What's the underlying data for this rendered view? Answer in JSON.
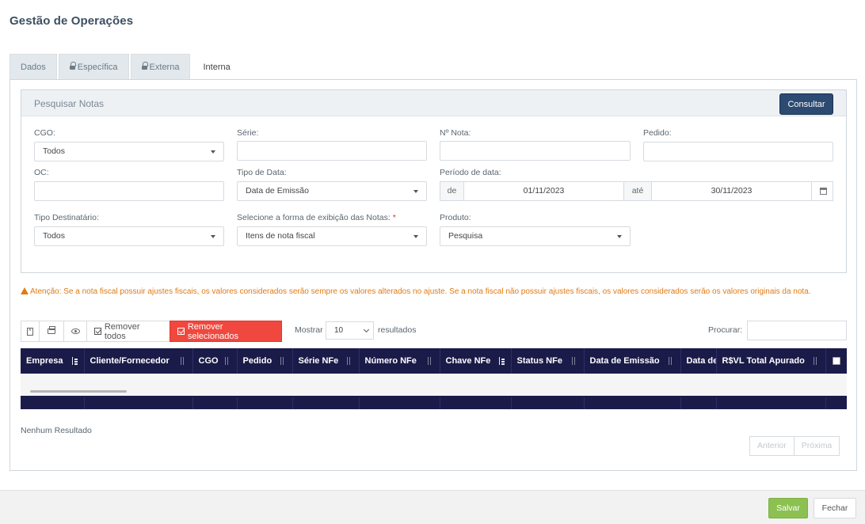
{
  "title": "Gestão de Operações",
  "tabs": [
    {
      "label": "Dados",
      "locked": false,
      "active": false
    },
    {
      "label": "Específica",
      "locked": true,
      "active": false
    },
    {
      "label": "Externa",
      "locked": true,
      "active": false
    },
    {
      "label": "Interna",
      "locked": false,
      "active": true
    }
  ],
  "search": {
    "title": "Pesquisar Notas",
    "consult_label": "Consultar",
    "fields": {
      "cgo": {
        "label": "CGO:",
        "value": "Todos"
      },
      "serie": {
        "label": "Série:",
        "value": ""
      },
      "nota": {
        "label": "Nº Nota:",
        "value": ""
      },
      "pedido": {
        "label": "Pedido:",
        "value": ""
      },
      "oc": {
        "label": "OC:",
        "value": ""
      },
      "tipo_data": {
        "label": "Tipo de Data:",
        "value": "Data de Emissão"
      },
      "periodo": {
        "label": "Período de data:",
        "de": "de",
        "start": "01/11/2023",
        "ate": "até",
        "end": "30/11/2023"
      },
      "tipo_destinatario": {
        "label": "Tipo Destinatário:",
        "value": "Todos"
      },
      "forma_exibicao": {
        "label": "Selecione a forma de exibição das Notas:",
        "required": "*",
        "value": "Itens de nota fiscal"
      },
      "produto": {
        "label": "Produto:",
        "value": "Pesquisa"
      }
    }
  },
  "warning": "Atenção: Se a nota fiscal possuir ajustes fiscais, os valores considerados serão sempre os valores alterados no ajuste. Se a nota fiscal não possuir ajustes fiscais, os valores considerados serão os valores originais da nota.",
  "toolbar": {
    "remove_all": "Remover todos",
    "remove_selected": "Remover selecionados",
    "show_label": "Mostrar",
    "page_length": "10",
    "results_label": "resultados",
    "search_label": "Procurar:"
  },
  "table": {
    "columns": [
      "Empresa",
      "Cliente/Fornecedor",
      "CGO",
      "Pedido",
      "Série NFe",
      "Número NFe",
      "Chave NFe",
      "Status NFe",
      "Data de Emissão",
      "Data de",
      "R$VL Total Apurado"
    ],
    "empty_text": "Nenhum Resultado"
  },
  "pager": {
    "prev": "Anterior",
    "next": "Próxima"
  },
  "footer": {
    "save": "Salvar",
    "close": "Fechar"
  },
  "colors": {
    "header_bg": "#1b1b4a",
    "consult": "#2c4a72",
    "remove_selected": "#f0483e",
    "save": "#8cc152",
    "warning": "#e07b15"
  }
}
